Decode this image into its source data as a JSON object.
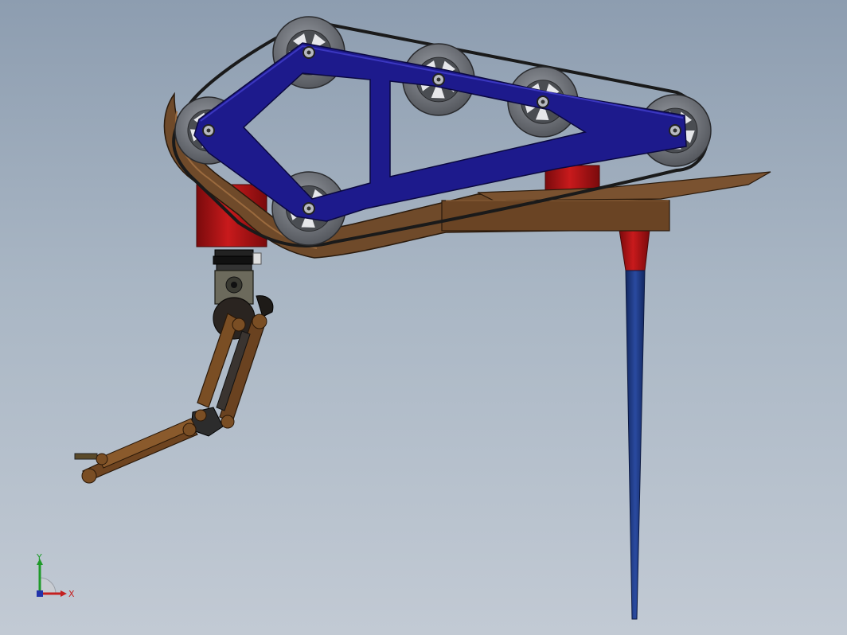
{
  "view": {
    "background_top": "#8d9db0",
    "background_bottom": "#c2cad4"
  },
  "model": {
    "colors": {
      "frame_blue": "#1d1a8c",
      "bronze": "#6f4a2a",
      "red_mount": "#b41416",
      "leg_blue": "#1c3a86",
      "pulley_gray": "#6b6e74",
      "belt": "#1a1a1a"
    }
  },
  "triad": {
    "y_label": "Y",
    "x_label": "X",
    "y_color": "#1f9a2a",
    "x_color": "#c42020",
    "z_color": "#2233aa"
  }
}
